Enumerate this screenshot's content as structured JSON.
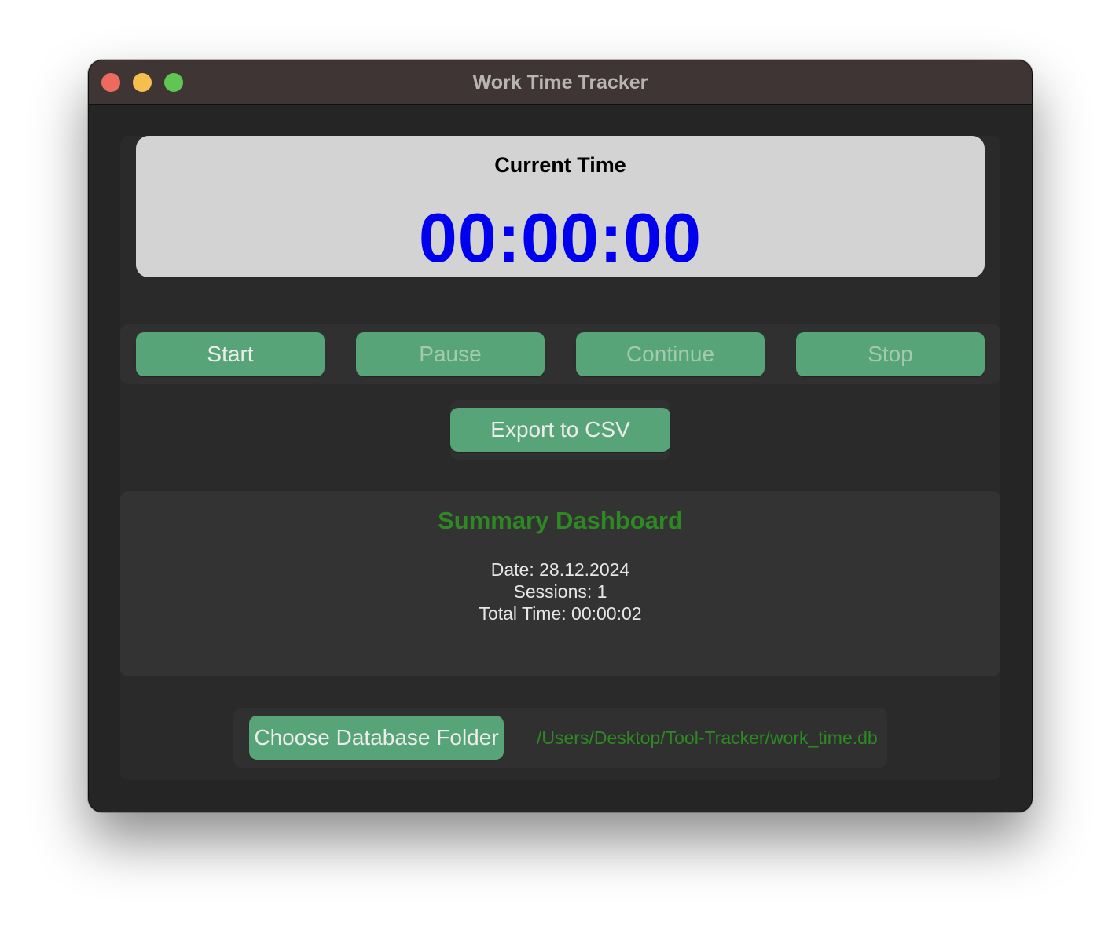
{
  "window": {
    "title": "Work Time Tracker"
  },
  "timer": {
    "label": "Current Time",
    "value": "00:00:00"
  },
  "controls": {
    "start_label": "Start",
    "pause_label": "Pause",
    "continue_label": "Continue",
    "stop_label": "Stop",
    "export_label": "Export to CSV"
  },
  "summary": {
    "title": "Summary Dashboard",
    "date_line": "Date: 28.12.2024",
    "sessions_line": "Sessions: 1",
    "total_time_line": "Total Time: 00:00:02"
  },
  "database": {
    "choose_label": "Choose Database Folder",
    "path": "/Users/Desktop/Tool-Tracker/work_time.db"
  },
  "colors": {
    "button_bg": "#56a477",
    "timer_text": "#0000ee",
    "accent_green": "#2d8a22",
    "card_bg": "#d3d3d3"
  }
}
